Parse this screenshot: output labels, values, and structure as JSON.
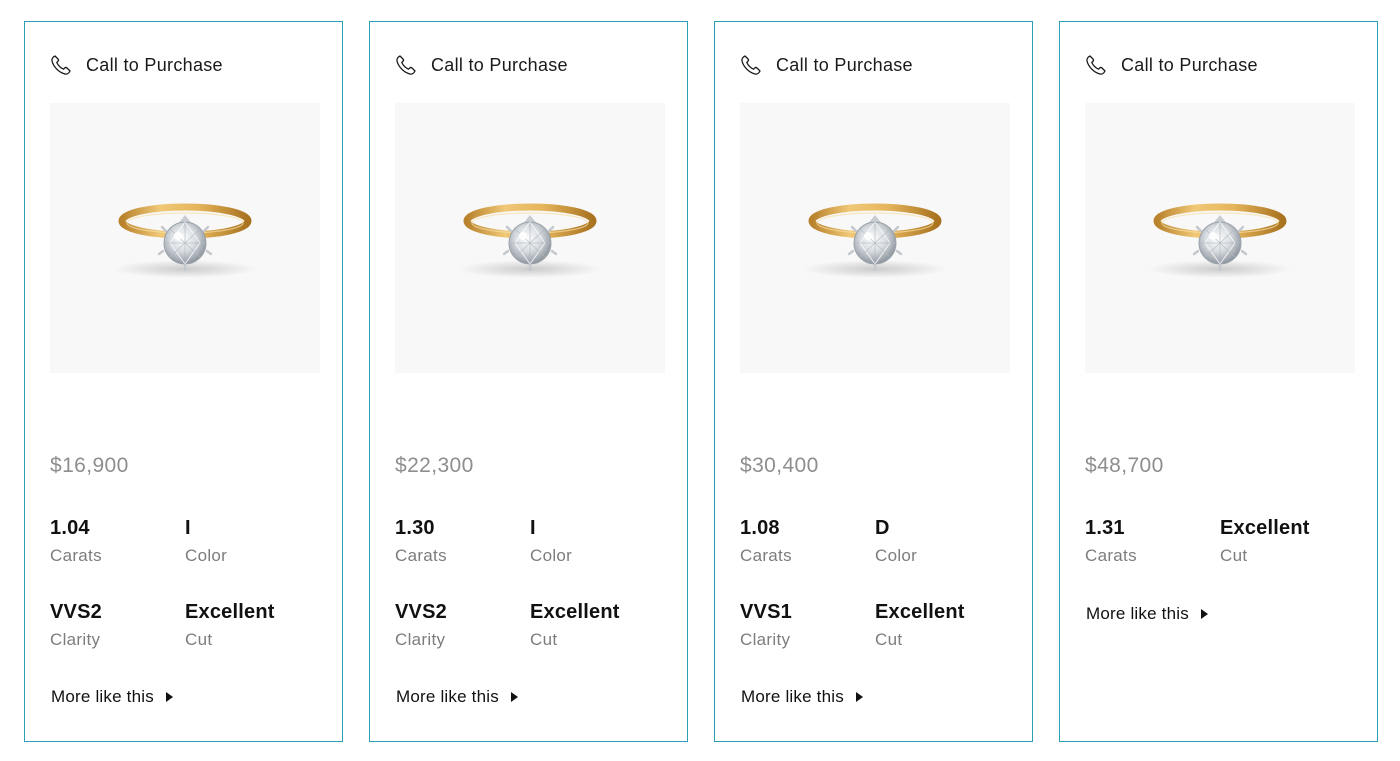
{
  "cards": [
    {
      "call_label": "Call to Purchase",
      "price": "$16,900",
      "carats": "1.04",
      "carats_label": "Carats",
      "color": "I",
      "color_label": "Color",
      "clarity": "VVS2",
      "clarity_label": "Clarity",
      "cut": "Excellent",
      "cut_label": "Cut",
      "more_label": "More like this"
    },
    {
      "call_label": "Call to Purchase",
      "price": "$22,300",
      "carats": "1.30",
      "carats_label": "Carats",
      "color": "I",
      "color_label": "Color",
      "clarity": "VVS2",
      "clarity_label": "Clarity",
      "cut": "Excellent",
      "cut_label": "Cut",
      "more_label": "More like this"
    },
    {
      "call_label": "Call to Purchase",
      "price": "$30,400",
      "carats": "1.08",
      "carats_label": "Carats",
      "color": "D",
      "color_label": "Color",
      "clarity": "VVS1",
      "clarity_label": "Clarity",
      "cut": "Excellent",
      "cut_label": "Cut",
      "more_label": "More like this"
    },
    {
      "call_label": "Call to Purchase",
      "price": "$48,700",
      "carats": "1.31",
      "carats_label": "Carats",
      "cut": "Excellent",
      "cut_label": "Cut",
      "more_label": "More like this"
    }
  ],
  "colors": {
    "card_border": "#2a9fb5",
    "price_text": "#8e8e8e",
    "label_text": "#7d7d7d",
    "ring_gold": "#d9a441"
  },
  "icons": {
    "call": "phone-icon",
    "more": "caret-right-icon",
    "product": "ring-image"
  }
}
